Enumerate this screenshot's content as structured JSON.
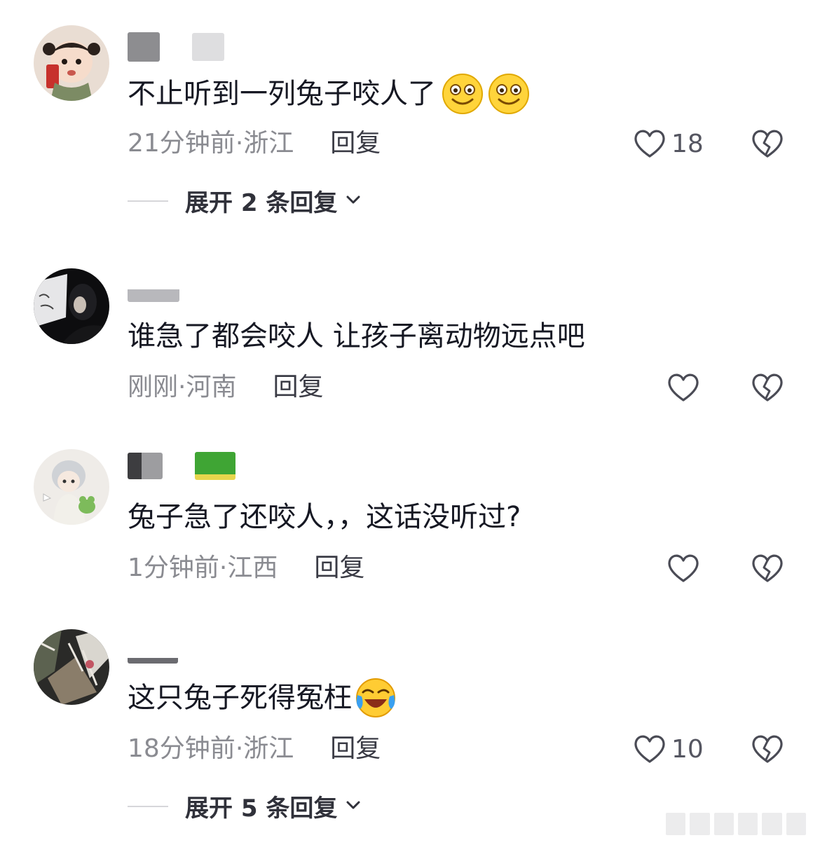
{
  "comments": [
    {
      "text": "不止听到一列兔子咬人了",
      "emojis": [
        "grinning-face-icon",
        "grinning-face-icon"
      ],
      "time": "21分钟前",
      "location": "浙江",
      "reply_label": "回复",
      "likes": "18",
      "expand_label": "展开 2 条回复"
    },
    {
      "text": "谁急了都会咬人 让孩子离动物远点吧",
      "time": "刚刚",
      "location": "河南",
      "reply_label": "回复"
    },
    {
      "text": "兔子急了还咬人，，这话没听过?",
      "time": "1分钟前",
      "location": "江西",
      "reply_label": "回复"
    },
    {
      "text": "这只兔子死得冤枉",
      "emojis": [
        "laughing-crying-face-icon"
      ],
      "time": "18分钟前",
      "location": "浙江",
      "reply_label": "回复",
      "likes": "10",
      "expand_label": "展开 5 条回复"
    }
  ],
  "separator": " · ",
  "colors": {
    "text_primary": "#161823",
    "text_meta": "#8a8b91",
    "icon": "#4a4b55"
  }
}
